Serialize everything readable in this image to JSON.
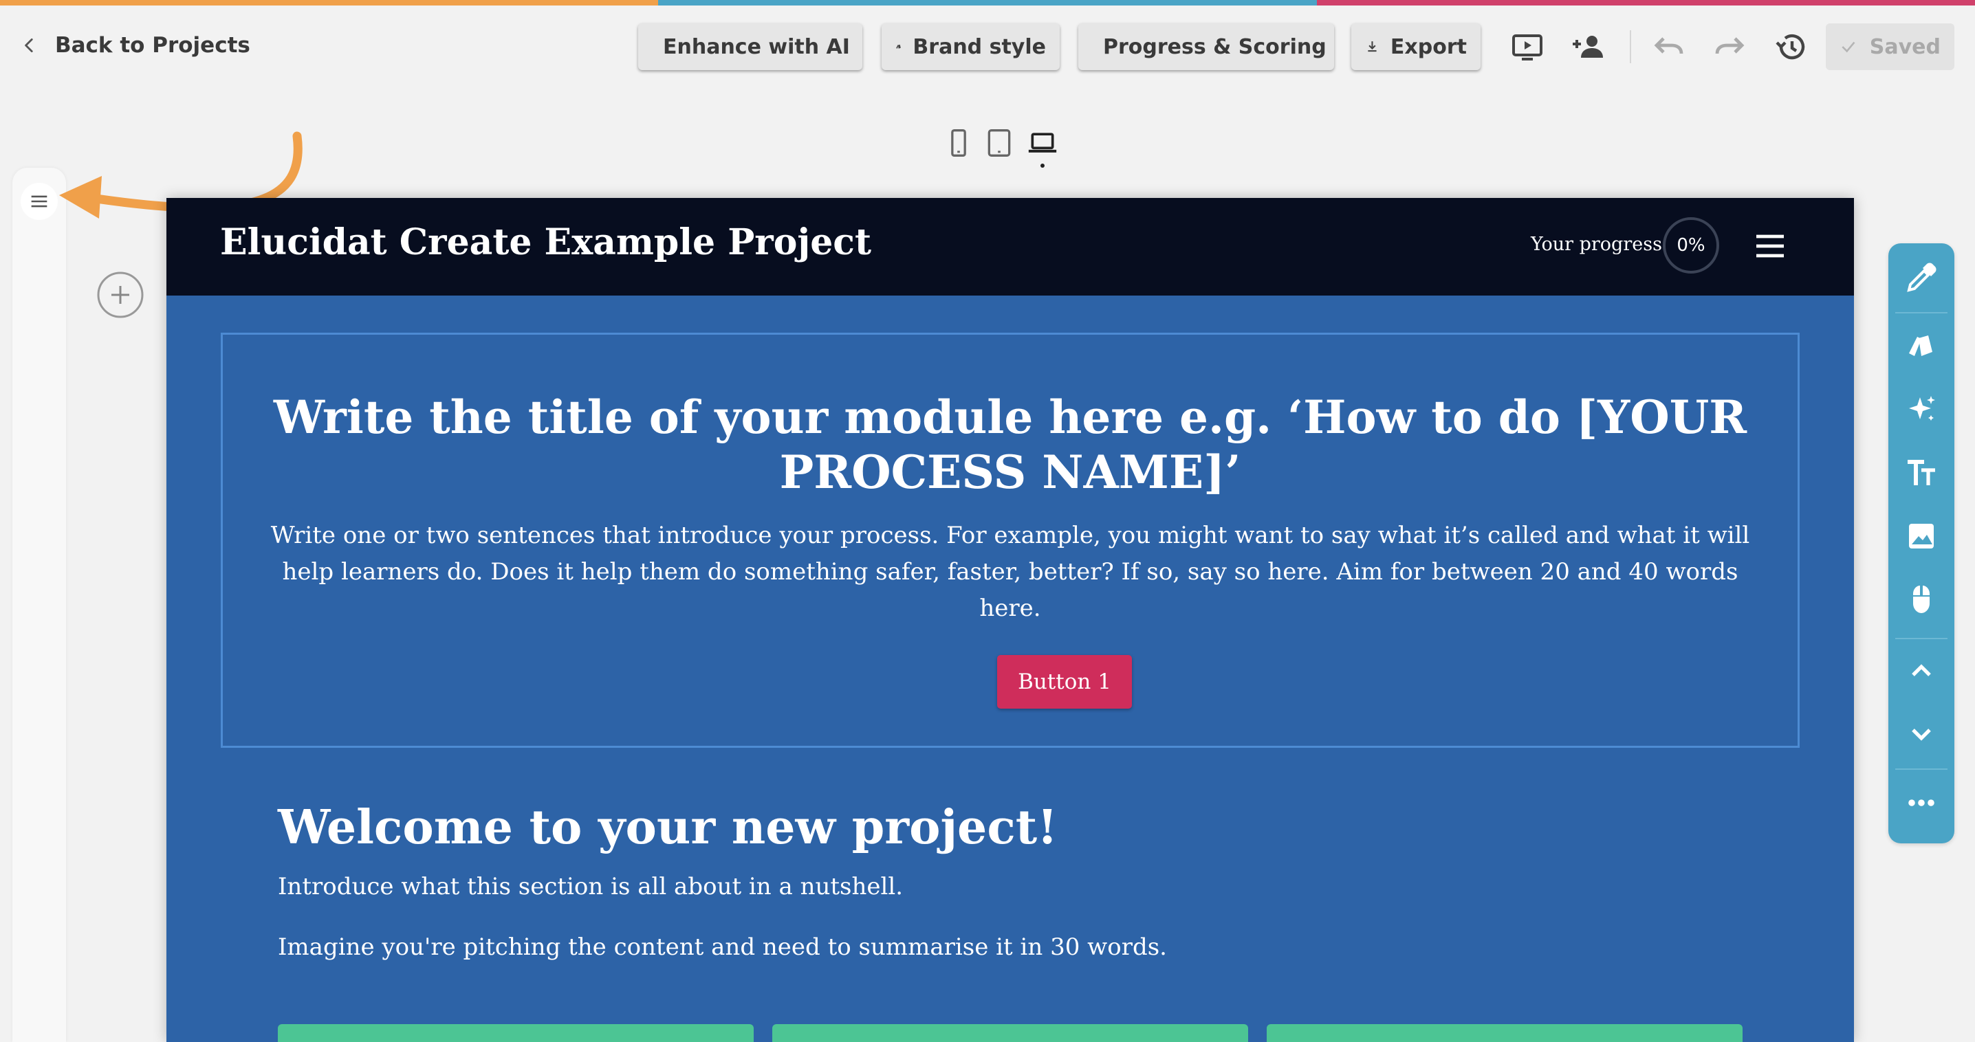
{
  "topbar": {
    "back_label": "Back to Projects",
    "buttons": {
      "enhance": "Enhance with AI",
      "brand": "Brand style",
      "progress": "Progress & Scoring",
      "export": "Export"
    },
    "saved_label": "Saved",
    "icons": [
      "preview-icon",
      "add-user-icon",
      "undo-icon",
      "redo-icon",
      "history-icon"
    ],
    "stripe_colors": [
      "#f0a04a",
      "#4aa4c6",
      "#d0416b"
    ]
  },
  "devices": {
    "options": [
      "mobile",
      "tablet",
      "desktop"
    ],
    "selected": "desktop"
  },
  "project": {
    "title": "Elucidat Create Example Project",
    "progress_label": "Your progress",
    "progress_value": "0%",
    "hero": {
      "title": "Write the title of your module here e.g. ‘How to do [YOUR PROCESS NAME]’",
      "body": "Write one or two sentences that introduce your process. For example, you might want to say what it’s called and what it will help learners do. Does it help them do something safer, faster, better? If so, say so here. Aim for between 20 and 40 words here.",
      "button_label": "Button 1"
    },
    "section": {
      "heading": "Welcome to your new project!",
      "intro": "Introduce what this section is all about in a nutshell.",
      "pitch": "Imagine you're pitching the content and need to summarise it in 30 words."
    }
  },
  "colors": {
    "canvas": "#2d63a7",
    "header": "#070d1f",
    "button": "#cf2d5b",
    "card": "#4cc594",
    "toolbar": "#4aa4c6",
    "annotation_arrow": "#f0a04a"
  },
  "right_toolbar": [
    "eyedropper-icon",
    "brand-icon",
    "ai-sparkle-icon",
    "text-size-icon",
    "image-icon",
    "mouse-icon",
    "chevron-up-icon",
    "chevron-down-icon",
    "more-icon"
  ]
}
